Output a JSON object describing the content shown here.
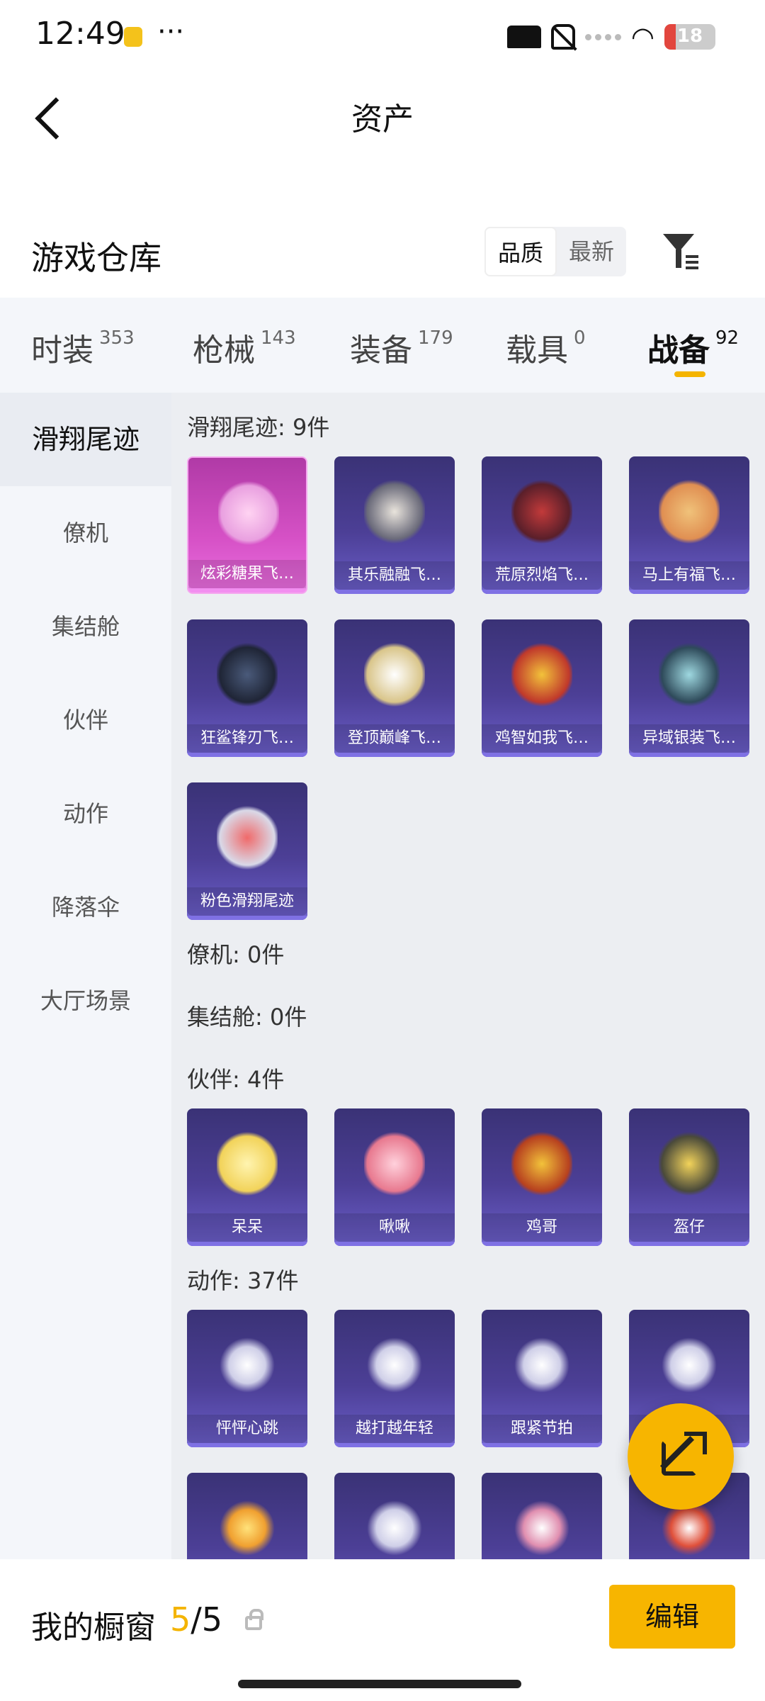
{
  "status_bar": {
    "time": "12:49",
    "more": "···",
    "battery": "18"
  },
  "header": {
    "title": "资产"
  },
  "warehouse": {
    "title": "游戏仓库",
    "sort_quality": "品质",
    "sort_newest": "最新"
  },
  "tabs": [
    {
      "label": "时装",
      "count": "353"
    },
    {
      "label": "枪械",
      "count": "143"
    },
    {
      "label": "装备",
      "count": "179"
    },
    {
      "label": "载具",
      "count": "0"
    },
    {
      "label": "战备",
      "count": "92"
    }
  ],
  "sidebar": [
    {
      "label": "滑翔尾迹"
    },
    {
      "label": "僚机"
    },
    {
      "label": "集结舱"
    },
    {
      "label": "伙伴"
    },
    {
      "label": "动作"
    },
    {
      "label": "降落伞"
    },
    {
      "label": "大厅场景"
    }
  ],
  "sections": {
    "trail": {
      "title": "滑翔尾迹: 9件",
      "items": [
        "炫彩糖果飞…",
        "其乐融融飞…",
        "荒原烈焰飞…",
        "马上有福飞…",
        "狂鲨锋刃飞…",
        "登顶巅峰飞…",
        "鸡智如我飞…",
        "异域银装飞…",
        "粉色滑翔尾迹"
      ]
    },
    "wingman": {
      "title": "僚机: 0件"
    },
    "pod": {
      "title": "集结舱: 0件"
    },
    "partner": {
      "title": "伙伴: 4件",
      "items": [
        "呆呆",
        "啾啾",
        "鸡哥",
        "盔仔"
      ]
    },
    "emote": {
      "title": "动作: 37件",
      "items": [
        "怦怦心跳",
        "越打越年轻",
        "跟紧节拍",
        ""
      ]
    }
  },
  "bottom_bar": {
    "label": "我的橱窗",
    "current": "5",
    "total": "/5",
    "edit": "编辑"
  },
  "colors": {
    "accent": "#f7b500",
    "card_purple": "#4c3f96",
    "card_pink": "#d651c6"
  }
}
